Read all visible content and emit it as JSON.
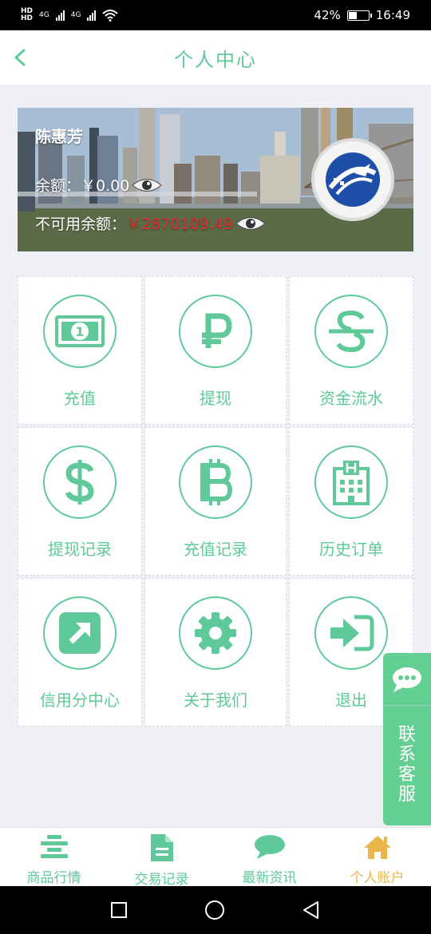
{
  "status_bar": {
    "hd_top": "HD",
    "hd_bottom": "HD",
    "net1": "4G",
    "net2": "4G",
    "battery": "42%",
    "time": "16:49"
  },
  "header": {
    "title": "个人中心",
    "back_icon": "chevron-left-icon"
  },
  "account": {
    "name": "陈惠芳",
    "balance_label": "余额：",
    "balance_value": "￥0.00",
    "frozen_label": "不可用余额：",
    "frozen_value": "￥2870109.49"
  },
  "menu": [
    {
      "label": "充值",
      "icon": "banknote-icon"
    },
    {
      "label": "提现",
      "icon": "ruble-icon"
    },
    {
      "label": "资金流水",
      "icon": "strikethrough-s-icon"
    },
    {
      "label": "提现记录",
      "icon": "dollar-icon"
    },
    {
      "label": "充值记录",
      "icon": "bitcoin-icon"
    },
    {
      "label": "历史订单",
      "icon": "hospital-icon"
    },
    {
      "label": "信用分中心",
      "icon": "external-link-icon"
    },
    {
      "label": "关于我们",
      "icon": "gear-icon"
    },
    {
      "label": "退出",
      "icon": "sign-in-icon"
    }
  ],
  "service": {
    "label": "联系客服",
    "icon": "chat-bubble-icon"
  },
  "tabbar": [
    {
      "label": "商品行情",
      "icon": "align-center-icon"
    },
    {
      "label": "交易记录",
      "icon": "document-icon"
    },
    {
      "label": "最新资讯",
      "icon": "chat-icon"
    },
    {
      "label": "个人账户",
      "icon": "home-icon"
    }
  ],
  "colors": {
    "accent": "#5fc99a",
    "active_tab": "#e8b64a",
    "frozen_value": "#e0302f",
    "service_bg": "#63cf92"
  }
}
